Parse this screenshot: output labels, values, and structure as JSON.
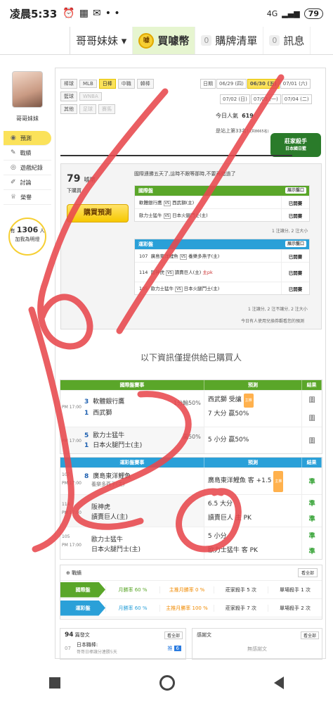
{
  "status": {
    "time": "凌晨5:33",
    "battery": "79",
    "network": "4G"
  },
  "topnav": {
    "user": "哥哥妹妹",
    "buy_coin": "買噱幣",
    "coin_icon": "噱",
    "cart_count": "0",
    "cart": "購牌清單",
    "msg_count": "0",
    "msg": "訊息"
  },
  "sidebar": {
    "username": "哥哥妹妹",
    "items": [
      {
        "label": "預測"
      },
      {
        "label": "戰績"
      },
      {
        "label": "遊戲紀錄"
      },
      {
        "label": "討論"
      },
      {
        "label": "榮譽"
      }
    ],
    "support_pre": "有",
    "support_count": "1306",
    "support_post": "人",
    "support_text": "加我為明燈"
  },
  "filters": {
    "row1": [
      "棒球",
      "MLB",
      "日棒",
      "中職",
      "韓棒"
    ],
    "row2": [
      "籃球",
      "WNBA"
    ],
    "row3": [
      "其他",
      "足球",
      "賽馬"
    ]
  },
  "dates": {
    "label": "日期",
    "items": [
      "06/29 (四)",
      "06/30 (五)",
      "07/01 (六)",
      "07/02 (日)",
      "07/03 (一)",
      "07/04 (二)"
    ]
  },
  "popularity": {
    "label": "今日人氣",
    "value": "619",
    "rank_text": "是站上第33名!",
    "rank_note": "(共8665名)"
  },
  "banner": {
    "line1": "莊家殺手",
    "line2": "日本國日籃"
  },
  "predict": {
    "price": "79",
    "unit": "噱幣",
    "buyer_text": "下購買",
    "buy_button": "購買預測",
    "notice": "國際連勝五天了,這時不跟等那時,不要再錯過了",
    "foot1": "1 注讓分, 2 注大小",
    "foot2": "1 注讓分, 2 注不讓分, 2 注大小",
    "footer": "今日有人使用兌換券觀看您的預測"
  },
  "intl": {
    "title": "國際盤",
    "expand": "展示盤口",
    "rows": [
      {
        "a": "軟體銀行鷹",
        "b": "西武獅(主)",
        "r": "已開賽"
      },
      {
        "a": "歐力士猛牛",
        "b": "日本火腿鬥士(主)",
        "r": "已開賽"
      }
    ]
  },
  "sport": {
    "title": "運彩盤",
    "expand": "展示盤口",
    "rows": [
      {
        "n": "107",
        "a": "廣島東洋鯉魚",
        "b": "養樂多燕子(主)",
        "r": "已開賽"
      },
      {
        "n": "114",
        "a": "阪神虎",
        "b": "讀賣巨人(主)",
        "pk": "主pk",
        "r": "已開賽"
      },
      {
        "n": "105",
        "a": "歐力士猛牛",
        "b": "日本火腿鬥士(主)",
        "r": "已開賽"
      }
    ]
  },
  "info_title": "以下資訊僅提供給已購買人",
  "t1": {
    "h1": "國際盤賽事",
    "h2": "預測",
    "h3": "結果",
    "rows": [
      {
        "time": "PM 17:00",
        "s1": "3",
        "t1": "軟體銀行鷹",
        "s2": "1",
        "t2": "西武獅",
        "hc": "1分輸50%",
        "p1": "西武獅 受讓",
        "p2": "7 大分 贏50%",
        "res": "圖"
      },
      {
        "time": "PM 17:00",
        "s1": "5",
        "t1": "歐力士猛牛",
        "s2": "1",
        "t2": "日本火腿鬥士(主)",
        "hc": "贏50%",
        "p1": "5 小分 贏50%",
        "p2": "",
        "res": "圖"
      }
    ]
  },
  "t2": {
    "h1": "運彩盤賽事",
    "h2": "預測",
    "h3": "結果",
    "rows": [
      {
        "no": "107",
        "time": "PM 17:00",
        "s1": "8",
        "t1": "廣島東洋鯉魚",
        "t2": "養樂多燕子(主)",
        "p1": "廣島東洋鯉魚 客 +1.5",
        "res": "準"
      },
      {
        "no": "114",
        "time": "PM 17:00",
        "t1": "阪神虎",
        "t2": "讀賣巨人(主)",
        "p1": "6.5 大分",
        "p2": "讀賣巨人 主 PK",
        "res": "準"
      },
      {
        "no": "105",
        "time": "PM 17:00",
        "t1": "歐力士猛牛",
        "t2": "日本火腿鬥士(主)",
        "p1": "5 小分",
        "p2": "歐力士猛牛 客 PK",
        "res": "準"
      }
    ]
  },
  "records": {
    "title": "戰績",
    "all": "看全部",
    "rows": [
      {
        "label": "國際盤",
        "m1": "月勝率 60 %",
        "m2": "主推月勝率 0 %",
        "m3": "莊家殺手 5 次",
        "m4": "單場殺手 1 次"
      },
      {
        "label": "運彩盤",
        "m1": "月勝率 60 %",
        "m2": "主推月勝率 100 %",
        "m3": "莊家殺手 7 次",
        "m4": "單場殺手 2 次"
      }
    ]
  },
  "articles": {
    "count": "94",
    "label": "篇發文",
    "all": "看全部",
    "date": "07",
    "item": "日本職棒:",
    "sub": "哥哥日棒讓分連勝5天",
    "badge_label": "推",
    "badge": "6"
  },
  "thanks": {
    "title": "感謝文",
    "all": "看全部",
    "empty": "無感謝文"
  }
}
